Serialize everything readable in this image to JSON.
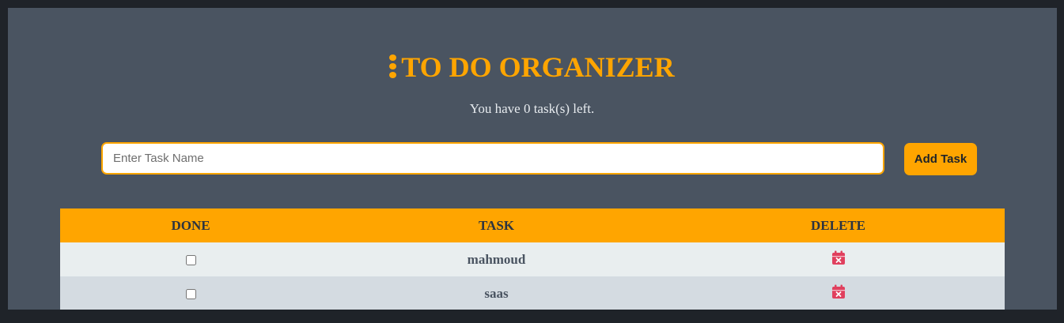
{
  "header": {
    "title": "TO DO ORGANIZER",
    "title_icon": "vertical-dots-icon",
    "subtitle": "You have 0 task(s) left."
  },
  "form": {
    "input_placeholder": "Enter Task Name",
    "input_value": "",
    "add_button_label": "Add Task"
  },
  "table": {
    "headers": [
      "DONE",
      "TASK",
      "DELETE"
    ],
    "rows": [
      {
        "done": false,
        "task": "mahmoud",
        "delete_icon": "calendar-x-icon"
      },
      {
        "done": false,
        "task": "saas",
        "delete_icon": "calendar-x-icon"
      }
    ]
  },
  "colors": {
    "accent": "#ffa500",
    "background": "#4a5461",
    "delete_icon": "#e0405e"
  }
}
